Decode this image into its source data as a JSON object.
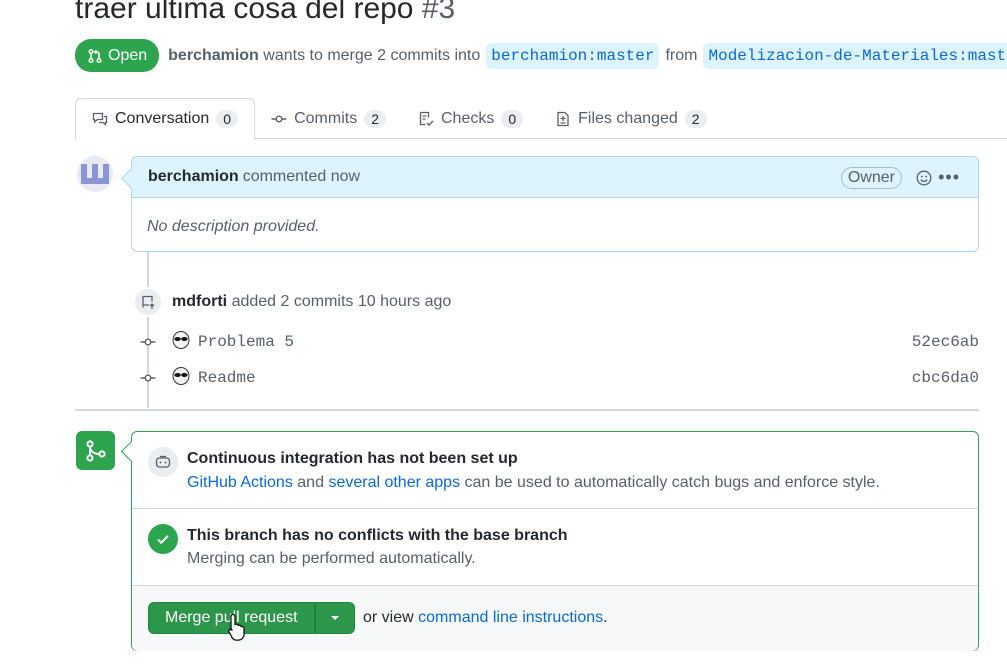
{
  "pr": {
    "title": "traer ultima cosa del repo",
    "number": "#3",
    "state": "Open",
    "author": "berchamion",
    "meta_text": "wants to merge 2 commits into",
    "base_branch": "berchamion:master",
    "from_text": "from",
    "head_branch": "Modelizacion-de-Materiales:master"
  },
  "tabs": [
    {
      "label": "Conversation",
      "count": "0"
    },
    {
      "label": "Commits",
      "count": "2"
    },
    {
      "label": "Checks",
      "count": "0"
    },
    {
      "label": "Files changed",
      "count": "2"
    }
  ],
  "comment": {
    "author": "berchamion",
    "action": "commented now",
    "role": "Owner",
    "body": "No description provided.",
    "more": "•••"
  },
  "commits_event": {
    "user": "mdforti",
    "text": "added 2 commits",
    "time": "10 hours ago",
    "commits": [
      {
        "message": "Problema 5",
        "sha": "52ec6ab"
      },
      {
        "message": "Readme",
        "sha": "cbc6da0"
      }
    ]
  },
  "merge": {
    "ci_title": "Continuous integration has not been set up",
    "ci_link1": "GitHub Actions",
    "ci_and": "and",
    "ci_link2": "several other apps",
    "ci_rest": "can be used to automatically catch bugs and enforce style.",
    "conflict_title": "This branch has no conflicts with the base branch",
    "conflict_sub": "Merging can be performed automatically.",
    "button_label": "Merge pull request",
    "or_view": "or view",
    "cli_link": "command line instructions",
    "period": "."
  },
  "colors": {
    "open_green": "#2da44e",
    "link_blue": "#0969da",
    "comment_header_bg": "#ddf4ff"
  }
}
